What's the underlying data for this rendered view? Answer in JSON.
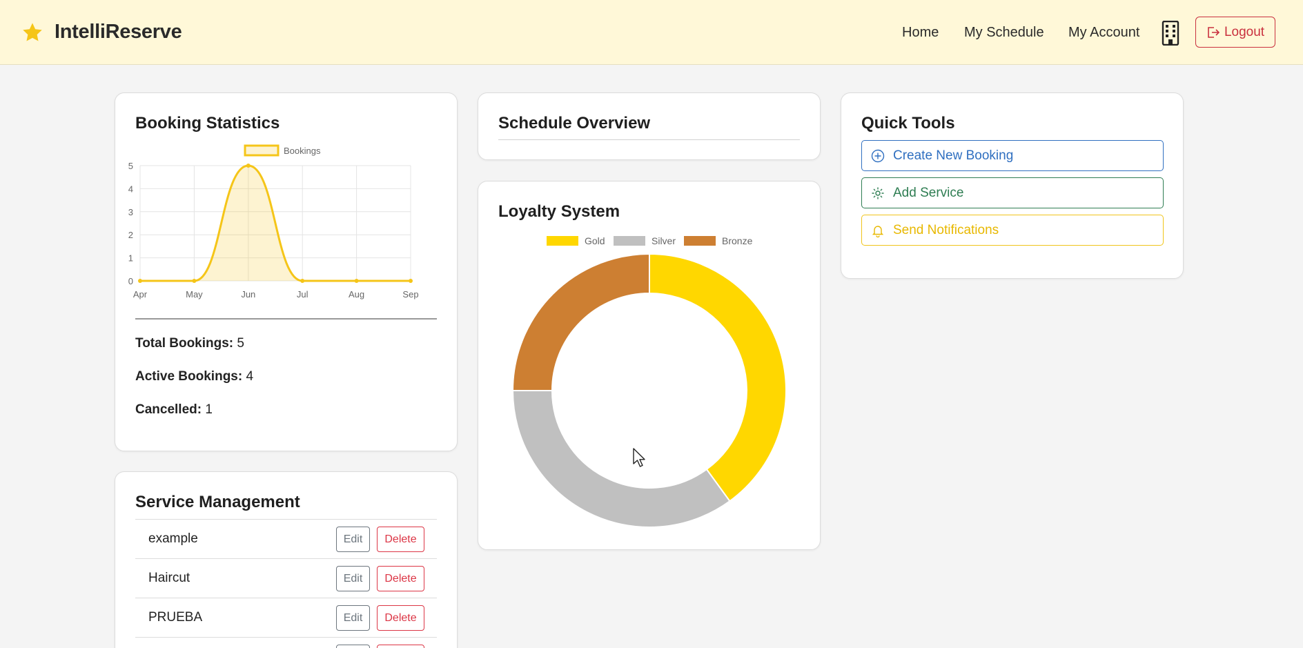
{
  "app": {
    "brand_name": "IntelliReserve",
    "brand_icon": "star-icon",
    "accent_color": "#f5c518",
    "header_bg": "#fff8d8"
  },
  "nav": {
    "home": "Home",
    "schedule": "My Schedule",
    "account": "My Account",
    "building_icon": "building-icon",
    "logout": "Logout"
  },
  "booking_stats": {
    "title": "Booking Statistics",
    "total_label": "Total Bookings:",
    "total_value": "5",
    "active_label": "Active Bookings:",
    "active_value": "4",
    "cancelled_label": "Cancelled:",
    "cancelled_value": "1"
  },
  "schedule": {
    "title": "Schedule Overview"
  },
  "loyalty": {
    "title": "Loyalty System"
  },
  "quick_tools": {
    "title": "Quick Tools",
    "create": "Create New Booking",
    "add_service": "Add Service",
    "notify": "Send Notifications"
  },
  "services": {
    "title": "Service Management",
    "edit_label": "Edit",
    "delete_label": "Delete",
    "items": [
      "example",
      "Haircut",
      "PRUEBA"
    ]
  },
  "chart_data": [
    {
      "type": "line",
      "x": [
        "Apr",
        "May",
        "Jun",
        "Jul",
        "Aug",
        "Sep"
      ],
      "series": [
        {
          "name": "Bookings",
          "values": [
            0,
            0,
            5,
            0,
            0,
            0
          ],
          "color": "#f5c518"
        }
      ],
      "ylim": [
        0,
        5
      ],
      "yticks": [
        0,
        1,
        2,
        3,
        4,
        5
      ],
      "grid": true,
      "legend": "top",
      "fill": true
    },
    {
      "type": "pie",
      "donut": true,
      "categories": [
        "Gold",
        "Silver",
        "Bronze"
      ],
      "values": [
        40,
        35,
        25
      ],
      "colors": [
        "#ffd700",
        "#c0c0c0",
        "#cd7f32"
      ],
      "legend": "top"
    }
  ]
}
